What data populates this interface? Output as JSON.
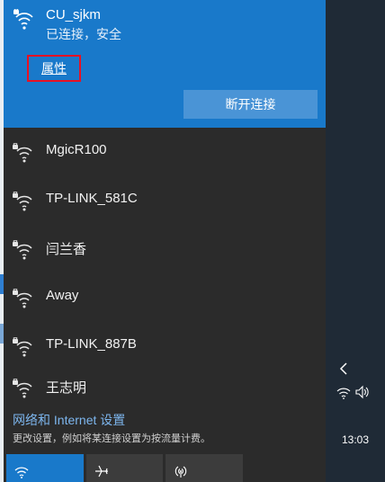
{
  "connected_network": {
    "name": "CU_sjkm",
    "status": "已连接，安全",
    "properties_label": "属性",
    "disconnect_label": "断开连接"
  },
  "networks": [
    {
      "name": "MgicR100"
    },
    {
      "name": "TP-LINK_581C"
    },
    {
      "name": "闫兰香"
    },
    {
      "name": "Away"
    },
    {
      "name": "TP-LINK_887B"
    },
    {
      "name": "王志明"
    }
  ],
  "settings": {
    "link": "网络和 Internet 设置",
    "description": "更改设置，例如将某连接设置为按流量计费。"
  },
  "quick_actions": [
    {
      "name": "wifi",
      "icon": "wifi-icon",
      "active": true
    },
    {
      "name": "airplane-mode",
      "icon": "airplane-icon",
      "active": false
    },
    {
      "name": "mobile-hotspot",
      "icon": "hotspot-icon",
      "active": false
    }
  ],
  "taskbar": {
    "time": "13:03"
  },
  "colors": {
    "accent": "#1979ca",
    "flyout_bg": "#2b2b2b",
    "link": "#7db6ee",
    "highlight_border": "#e81123"
  }
}
